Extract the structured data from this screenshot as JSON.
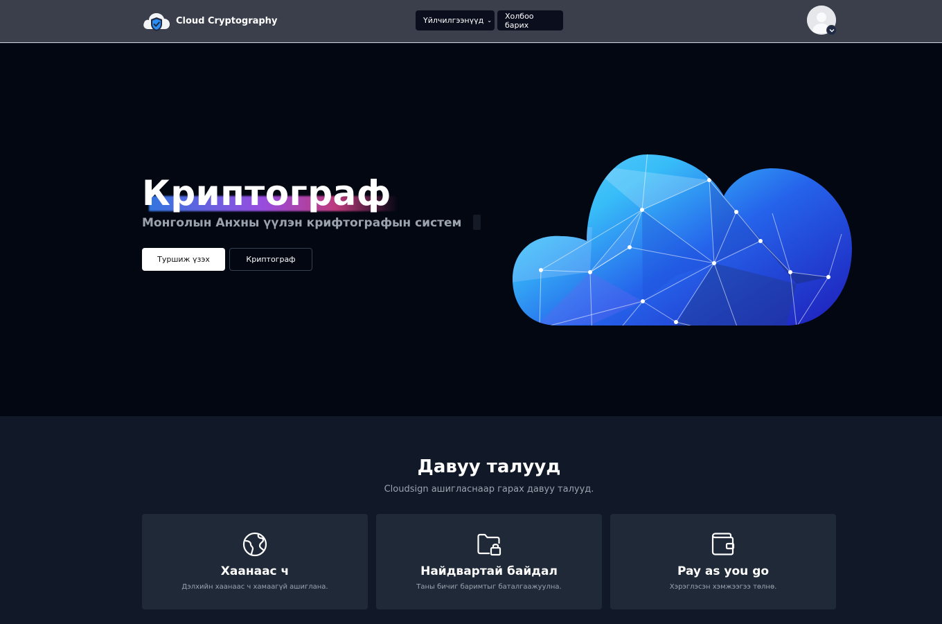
{
  "navbar": {
    "brand_name": "Cloud Cryptography",
    "menu": [
      {
        "label": "Үйлчилгээнүүд",
        "has_dropdown": true
      },
      {
        "label": "Холбоо барих",
        "has_dropdown": false
      }
    ],
    "avatar_icon": "user-avatar-icon"
  },
  "hero": {
    "title": "Криптограф",
    "subtitle": "Монголын Анхны үүлэн крифтографын систем",
    "primary_button": "Туршиж үзэх",
    "secondary_button": "Криптограф",
    "illustration": "cloud-network-illustration"
  },
  "features": {
    "title": "Давуу талууд",
    "subtitle": "Cloudsign ашигласнаар гарах давуу талууд.",
    "cards": [
      {
        "icon": "globe-icon",
        "title": "Хаанаас ч",
        "description": "Дэлхийн хаанаас ч хамаагүй ашиглана."
      },
      {
        "icon": "folder-lock-icon",
        "title": "Найдвартай байдал",
        "description": "Таны бичиг баримтыг баталгаажуулна."
      },
      {
        "icon": "wallet-icon",
        "title": "Pay as you go",
        "description": "Хэрэглэсэн хэмжээгээ төлнө."
      }
    ]
  },
  "colors": {
    "navbar_bg": "#3a3f4b",
    "hero_bg": "#030712",
    "section_bg": "#111827",
    "card_bg": "#1f2937",
    "accent_blue": "#3b82f6",
    "accent_purple": "#a855f7"
  }
}
